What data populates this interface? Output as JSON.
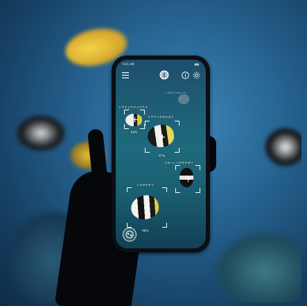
{
  "app": {
    "status_time": "9:41 AM",
    "status_battery": "▮▮▮"
  },
  "labels": {
    "label_top_right": "ノコギリハギ(シマ)",
    "label_left": "トゲチョウチョウウオ",
    "label_center": "ミナミハタタテダイ",
    "label_right": "コラーレハタタテダイ",
    "label_bottom": "ハタタテダイ"
  },
  "percents": {
    "pct_left": "84%",
    "pct_center": "97%",
    "pct_bottom": "96%"
  },
  "icons": {
    "menu": "menu-icon",
    "logo": "globe-logo-icon",
    "info": "info-icon",
    "settings": "gear-icon",
    "scan": "lens-scan-icon"
  },
  "colors": {
    "water": "#2a6b96",
    "accent_white": "#ffffff",
    "fish_yellow": "#e9c531"
  }
}
